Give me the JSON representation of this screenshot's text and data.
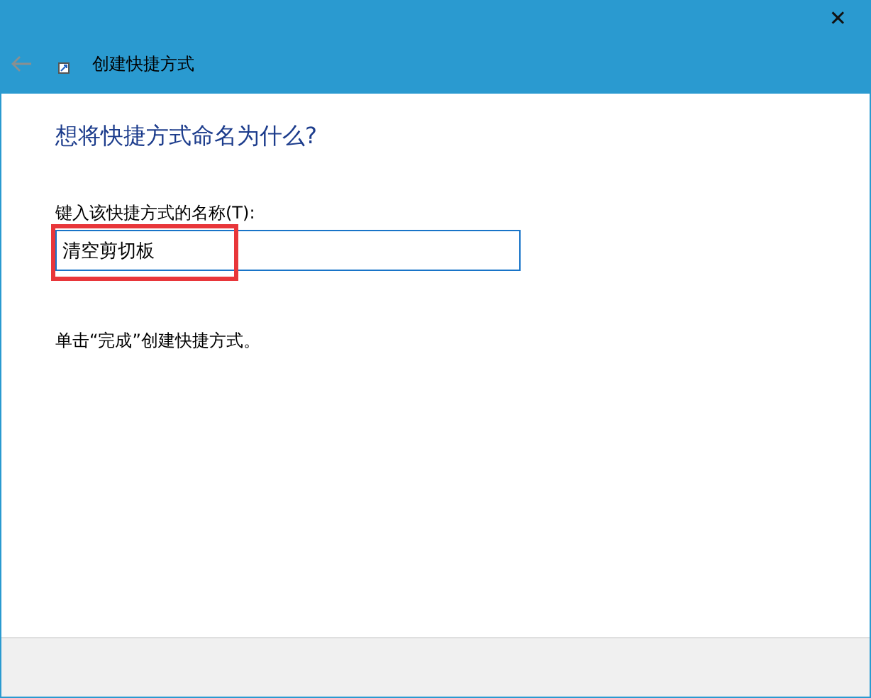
{
  "window": {
    "title": "创建快捷方式",
    "close": "✕"
  },
  "heading": "想将快捷方式命名为什么?",
  "name_field": {
    "label": "键入该快捷方式的名称(T):",
    "value": "清空剪切板",
    "highlighted": true
  },
  "hint": "单击“完成”创建快捷方式。"
}
